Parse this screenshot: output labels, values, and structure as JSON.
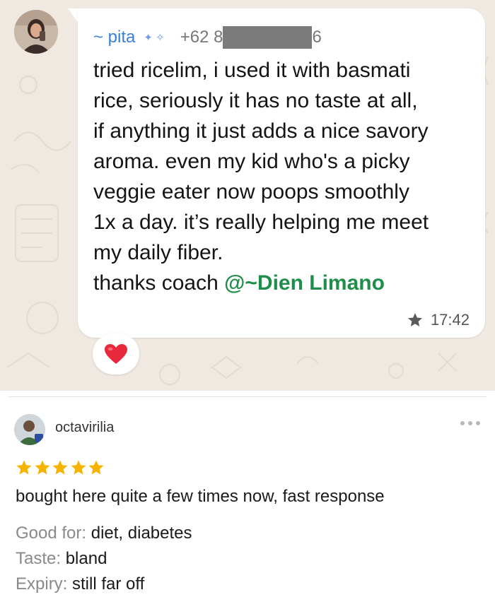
{
  "chat": {
    "sender_name": "~ pita",
    "sender_phone_prefix": "+62 8",
    "sender_phone_suffix": "6",
    "message_lines": "tried ricelim, i used it with basmati\nrice, seriously it has no taste at all,\nif anything it just adds a nice savory\naroma. even my kid who's a picky\nveggie eater now poops smoothly\n1x a day. it’s really helping me meet\nmy daily fiber.",
    "thanks_text": "thanks coach ",
    "mention": "@~Dien Limano",
    "time": "17:42",
    "reaction_icon": "red-heart-emoji",
    "starred_icon": "star-icon",
    "colors": {
      "background": "#efe9e1",
      "bubble": "#ffffff",
      "sender": "#3a7fd6",
      "mention": "#1e8e4a"
    }
  },
  "review": {
    "username": "octavirilia",
    "rating": 5,
    "rating_max": 5,
    "text": "bought here quite a few times now, fast response",
    "attributes": [
      {
        "label": "Good for: ",
        "value": "diet, diabetes"
      },
      {
        "label": "Taste: ",
        "value": "bland"
      },
      {
        "label": "Expiry: ",
        "value": "still far off"
      }
    ],
    "colors": {
      "star": "#f5b400",
      "label": "#8a8a8a"
    }
  }
}
